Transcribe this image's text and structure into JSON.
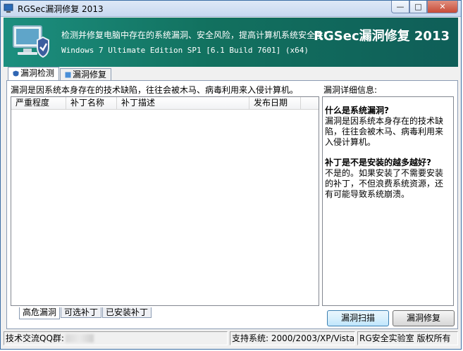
{
  "window": {
    "title": "RGSec漏洞修复 2013"
  },
  "banner": {
    "line1": "检测并修复电脑中存在的系统漏洞、安全风险，提高计算机系统安全性!",
    "line2": "Windows 7 Ultimate Edition SP1 [6.1 Build 7601] (x64)",
    "brand": "RGSec漏洞修复 2013"
  },
  "tabs": [
    {
      "label": "漏洞检测"
    },
    {
      "label": "漏洞修复"
    }
  ],
  "vuln_list": {
    "description": "漏洞是因系统本身存在的技术缺陷，往往会被木马、病毒利用来入侵计算机。",
    "columns": [
      "严重程度",
      "补丁名称",
      "补丁描述",
      "发布日期"
    ],
    "bottom_tabs": [
      "高危漏洞",
      "可选补丁",
      "已安装补丁"
    ]
  },
  "detail": {
    "label": "漏洞详细信息:",
    "q1": "什么是系统漏洞?",
    "a1": "漏洞是因系统本身存在的技术缺陷，往往会被木马、病毒利用来入侵计算机。",
    "q2": "补丁是不是安装的越多越好?",
    "a2": "不是的。如果安装了不需要安装的补丁，不但浪费系统资源，还有可能导致系统崩溃。"
  },
  "buttons": {
    "scan": "漏洞扫描",
    "repair": "漏洞修复"
  },
  "statusbar": {
    "qq": "技术交流QQ群:",
    "os": "支持系统: 2000/2003/XP/Vista/7",
    "copyright": "RG安全实验室 版权所有"
  }
}
